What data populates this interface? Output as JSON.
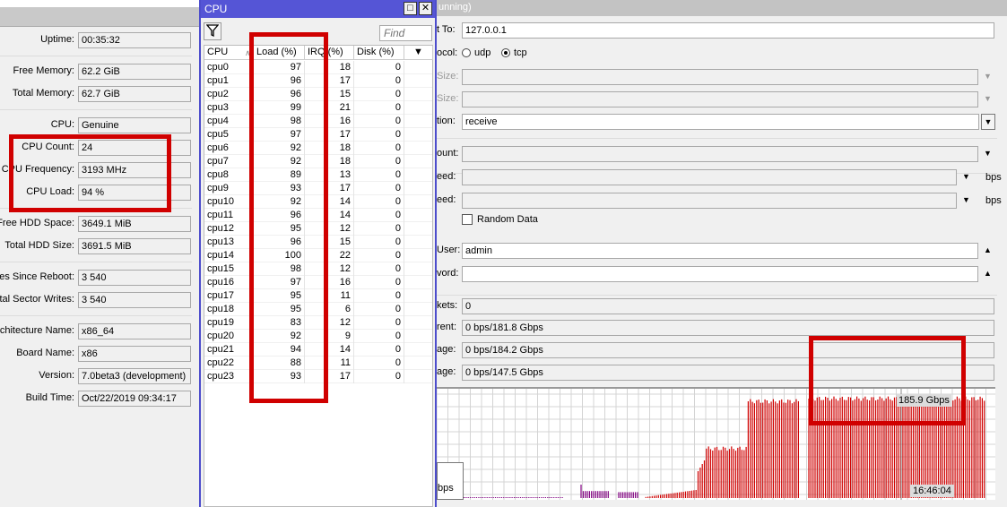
{
  "system": {
    "fields": [
      {
        "label": "Uptime:",
        "value": "00:35:32"
      },
      {
        "label": "Free Memory:",
        "value": "62.2 GiB"
      },
      {
        "label": "Total Memory:",
        "value": "62.7 GiB"
      },
      {
        "label": "CPU:",
        "value": "Genuine"
      },
      {
        "label": "CPU Count:",
        "value": "24"
      },
      {
        "label": "CPU Frequency:",
        "value": "3193 MHz"
      },
      {
        "label": "CPU Load:",
        "value": "94 %"
      },
      {
        "label": "Free HDD Space:",
        "value": "3649.1 MiB"
      },
      {
        "label": "Total HDD Size:",
        "value": "3691.5 MiB"
      },
      {
        "label": "Sector Writes Since Reboot:",
        "value": "3 540"
      },
      {
        "label": "Total Sector Writes:",
        "value": "3 540"
      },
      {
        "label": "Architecture Name:",
        "value": "x86_64"
      },
      {
        "label": "Board Name:",
        "value": "x86"
      },
      {
        "label": "Version:",
        "value": "7.0beta3 (development)"
      },
      {
        "label": "Build Time:",
        "value": "Oct/22/2019 09:34:17"
      }
    ]
  },
  "cpu_window": {
    "title": "CPU",
    "restore": "□",
    "close": "✕",
    "find_placeholder": "Find",
    "columns": [
      "CPU",
      "Load (%)",
      "IRQ (%)",
      "Disk (%)"
    ],
    "rows": [
      [
        "cpu0",
        "97",
        "18",
        "0"
      ],
      [
        "cpu1",
        "96",
        "17",
        "0"
      ],
      [
        "cpu2",
        "96",
        "15",
        "0"
      ],
      [
        "cpu3",
        "99",
        "21",
        "0"
      ],
      [
        "cpu4",
        "98",
        "16",
        "0"
      ],
      [
        "cpu5",
        "97",
        "17",
        "0"
      ],
      [
        "cpu6",
        "92",
        "18",
        "0"
      ],
      [
        "cpu7",
        "92",
        "18",
        "0"
      ],
      [
        "cpu8",
        "89",
        "13",
        "0"
      ],
      [
        "cpu9",
        "93",
        "17",
        "0"
      ],
      [
        "cpu10",
        "92",
        "14",
        "0"
      ],
      [
        "cpu11",
        "96",
        "14",
        "0"
      ],
      [
        "cpu12",
        "95",
        "12",
        "0"
      ],
      [
        "cpu13",
        "96",
        "15",
        "0"
      ],
      [
        "cpu14",
        "100",
        "22",
        "0"
      ],
      [
        "cpu15",
        "98",
        "12",
        "0"
      ],
      [
        "cpu16",
        "97",
        "16",
        "0"
      ],
      [
        "cpu17",
        "95",
        "11",
        "0"
      ],
      [
        "cpu18",
        "95",
        "6",
        "0"
      ],
      [
        "cpu19",
        "83",
        "12",
        "0"
      ],
      [
        "cpu20",
        "92",
        "9",
        "0"
      ],
      [
        "cpu21",
        "94",
        "14",
        "0"
      ],
      [
        "cpu22",
        "88",
        "11",
        "0"
      ],
      [
        "cpu23",
        "93",
        "17",
        "0"
      ]
    ]
  },
  "bandwidth_test": {
    "title": "unning)",
    "connect_to": {
      "label": "t To:",
      "value": "127.0.0.1"
    },
    "protocol": {
      "label": "ocol:",
      "options": [
        "udp",
        "tcp"
      ],
      "selected": "tcp"
    },
    "local_udp_tx_size": {
      "label": "Size:",
      "value": ""
    },
    "remote_udp_tx_size": {
      "label": "Size:",
      "value": ""
    },
    "direction": {
      "label": "tion:",
      "value": "receive"
    },
    "connection_count": {
      "label": "ount:",
      "value": ""
    },
    "local_tx_speed": {
      "label": "eed:",
      "value": "",
      "unit": "bps"
    },
    "remote_tx_speed": {
      "label": "eed:",
      "value": "",
      "unit": "bps"
    },
    "random_data": {
      "label": "Random Data",
      "checked": false
    },
    "user": {
      "label": "User:",
      "value": "admin"
    },
    "password": {
      "label": "vord:",
      "value": ""
    },
    "lost_packets": {
      "label": "kets:",
      "value": "0"
    },
    "tx_rx_current": {
      "label": "rent:",
      "value": "0 bps/181.8 Gbps"
    },
    "tx_rx_10s_average": {
      "label": "age:",
      "value": "0 bps/184.2 Gbps"
    },
    "tx_rx_total_average": {
      "label": "age:",
      "value": "0 bps/147.5 Gbps"
    },
    "graph": {
      "unit": "Gbps",
      "legend_text": "bps",
      "cursor_value": "185.9 Gbps",
      "cursor_time": "16:46:04",
      "tx_color": "#800080",
      "rx_color": "#d00000",
      "segments": [
        {
          "count": 60,
          "value": 1,
          "color": "purple"
        },
        {
          "gap": 8
        },
        {
          "count": 1,
          "value": 25,
          "color": "purple"
        },
        {
          "count": 13,
          "value": 13,
          "color": "purple"
        },
        {
          "gap": 4
        },
        {
          "count": 10,
          "value": 11,
          "color": "purple"
        },
        {
          "gap": 3
        },
        {
          "ramp": 25,
          "from": 2,
          "to": 15,
          "color": "red"
        },
        {
          "ramp": 4,
          "from": 50,
          "to": 70,
          "color": "red"
        },
        {
          "count": 20,
          "value": 92,
          "color": "red"
        },
        {
          "count": 25,
          "value": 180,
          "color": "red"
        },
        {
          "gap": 4
        },
        {
          "count": 85,
          "value": 185,
          "color": "red"
        }
      ]
    }
  },
  "colors": {
    "highlight": "#d00000",
    "cpu_title": "#5555d6"
  }
}
